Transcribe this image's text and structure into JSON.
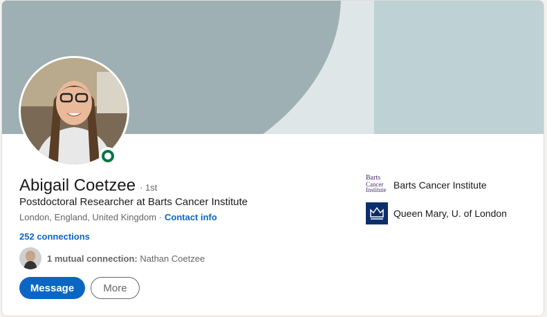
{
  "profile": {
    "name": "Abigail Coetzee",
    "degree": "· 1st",
    "headline": "Postdoctoral Researcher at Barts Cancer Institute",
    "location": "London, England, United Kingdom ·",
    "contact_info": "Contact info",
    "connections": "252 connections",
    "mutual_prefix": "1 mutual connection:",
    "mutual_name": " Nathan Coetzee"
  },
  "actions": {
    "message": "Message",
    "more": "More"
  },
  "organizations": [
    {
      "name": "Barts Cancer Institute",
      "logo_text": [
        "Barts",
        "Cancer",
        "Institute"
      ]
    },
    {
      "name": "Queen Mary, U. of London"
    }
  ],
  "colors": {
    "accent": "#0a66c2",
    "online": "#057642",
    "banner_dark": "#9eb0b4",
    "banner_light": "#bed1d5"
  }
}
